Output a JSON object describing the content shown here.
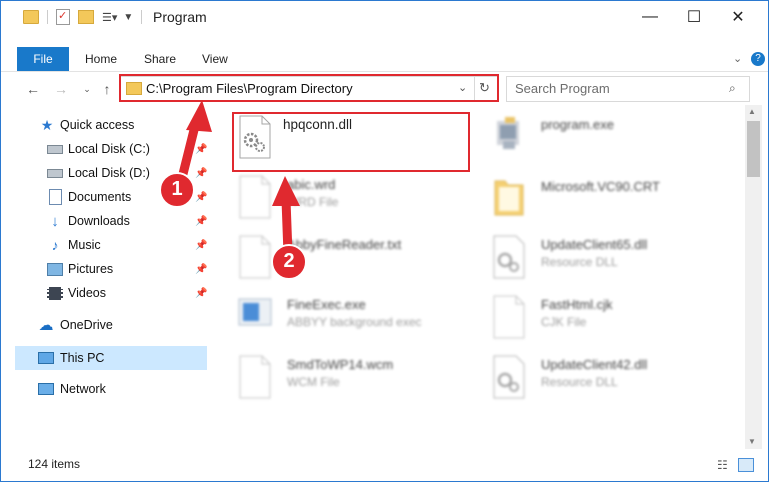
{
  "window": {
    "title": "Program",
    "controls": {
      "minimize": "—",
      "maximize": "☐",
      "close": "✕"
    }
  },
  "ribbon": {
    "tabs": [
      "File",
      "Home",
      "Share",
      "View"
    ]
  },
  "address": {
    "path": "C:\\Program Files\\Program Directory"
  },
  "search": {
    "placeholder": "Search Program"
  },
  "nav": {
    "items": [
      {
        "label": "Quick access",
        "icon": "star-icon",
        "pinned": false
      },
      {
        "label": "Local Disk (C:)",
        "icon": "drive-icon",
        "pinned": true
      },
      {
        "label": "Local Disk (D:)",
        "icon": "drive-icon",
        "pinned": true
      },
      {
        "label": "Documents",
        "icon": "documents-icon",
        "pinned": true
      },
      {
        "label": "Downloads",
        "icon": "download-icon",
        "pinned": true
      },
      {
        "label": "Music",
        "icon": "music-icon",
        "pinned": true
      },
      {
        "label": "Pictures",
        "icon": "pictures-icon",
        "pinned": true
      },
      {
        "label": "Videos",
        "icon": "videos-icon",
        "pinned": true
      },
      {
        "label": "OneDrive",
        "icon": "cloud-icon",
        "pinned": false
      },
      {
        "label": "This PC",
        "icon": "computer-icon",
        "pinned": false
      },
      {
        "label": "Network",
        "icon": "network-icon",
        "pinned": false
      }
    ]
  },
  "files": [
    {
      "name": "hpqconn.dll",
      "type": "",
      "icon": "dll-icon"
    },
    {
      "name": "program.exe",
      "type": "",
      "icon": "exe-icon"
    },
    {
      "name": "abic.wrd",
      "type": "WRD File",
      "icon": "file-icon"
    },
    {
      "name": "Microsoft.VC90.CRT",
      "type": "",
      "icon": "folder-icon"
    },
    {
      "name": "AbbyFineReader.txt",
      "type": "",
      "icon": "file-icon"
    },
    {
      "name": "UpdateClient65.dll",
      "type": "Resource DLL",
      "icon": "dll-icon"
    },
    {
      "name": "FineExec.exe",
      "type": "ABBYY background exec",
      "icon": "exe-icon"
    },
    {
      "name": "FastHtml.cjk",
      "type": "CJK File",
      "icon": "file-icon"
    },
    {
      "name": "SmdToWP14.wcm",
      "type": "WCM File",
      "icon": "file-icon"
    },
    {
      "name": "UpdateClient42.dll",
      "type": "Resource DLL",
      "icon": "dll-icon"
    }
  ],
  "status": {
    "count": "124 items"
  },
  "annotations": {
    "markers": [
      "1",
      "2"
    ],
    "color": "#e0292f"
  },
  "colors": {
    "accent": "#1979ca",
    "selection": "#cce8ff"
  }
}
